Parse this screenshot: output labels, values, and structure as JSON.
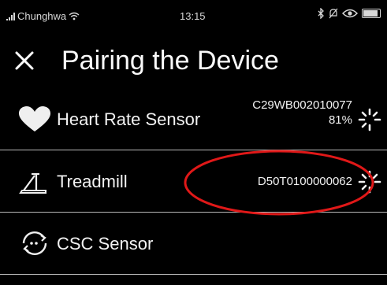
{
  "status_bar": {
    "carrier": "Chunghwa",
    "time": "13:15"
  },
  "header": {
    "title": "Pairing the Device"
  },
  "devices": [
    {
      "label": "Heart Rate Sensor",
      "id": "C29WB002010077",
      "battery": "81%",
      "icon": "heart-icon"
    },
    {
      "label": "Treadmill",
      "id": "D50T0100000062",
      "icon": "treadmill-icon"
    },
    {
      "label": "CSC Sensor",
      "id": "",
      "icon": "csc-sensor-icon"
    }
  ],
  "colors": {
    "background": "#000000",
    "text": "#ffffff",
    "divider": "#b9b9b9",
    "annotation": "#e01818"
  }
}
